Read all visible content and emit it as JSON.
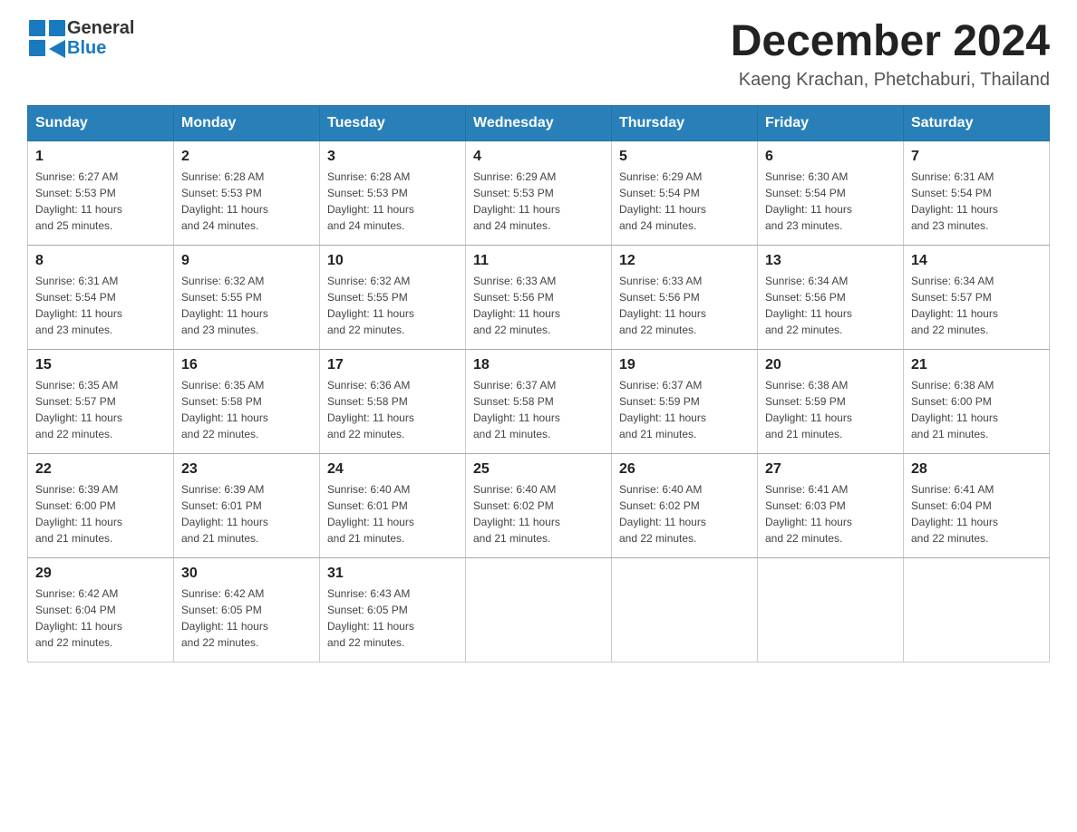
{
  "header": {
    "logo_general": "General",
    "logo_blue": "Blue",
    "month_title": "December 2024",
    "subtitle": "Kaeng Krachan, Phetchaburi, Thailand"
  },
  "days_of_week": [
    "Sunday",
    "Monday",
    "Tuesday",
    "Wednesday",
    "Thursday",
    "Friday",
    "Saturday"
  ],
  "weeks": [
    [
      {
        "day": "1",
        "sunrise": "6:27 AM",
        "sunset": "5:53 PM",
        "daylight": "11 hours and 25 minutes."
      },
      {
        "day": "2",
        "sunrise": "6:28 AM",
        "sunset": "5:53 PM",
        "daylight": "11 hours and 24 minutes."
      },
      {
        "day": "3",
        "sunrise": "6:28 AM",
        "sunset": "5:53 PM",
        "daylight": "11 hours and 24 minutes."
      },
      {
        "day": "4",
        "sunrise": "6:29 AM",
        "sunset": "5:53 PM",
        "daylight": "11 hours and 24 minutes."
      },
      {
        "day": "5",
        "sunrise": "6:29 AM",
        "sunset": "5:54 PM",
        "daylight": "11 hours and 24 minutes."
      },
      {
        "day": "6",
        "sunrise": "6:30 AM",
        "sunset": "5:54 PM",
        "daylight": "11 hours and 23 minutes."
      },
      {
        "day": "7",
        "sunrise": "6:31 AM",
        "sunset": "5:54 PM",
        "daylight": "11 hours and 23 minutes."
      }
    ],
    [
      {
        "day": "8",
        "sunrise": "6:31 AM",
        "sunset": "5:54 PM",
        "daylight": "11 hours and 23 minutes."
      },
      {
        "day": "9",
        "sunrise": "6:32 AM",
        "sunset": "5:55 PM",
        "daylight": "11 hours and 23 minutes."
      },
      {
        "day": "10",
        "sunrise": "6:32 AM",
        "sunset": "5:55 PM",
        "daylight": "11 hours and 22 minutes."
      },
      {
        "day": "11",
        "sunrise": "6:33 AM",
        "sunset": "5:56 PM",
        "daylight": "11 hours and 22 minutes."
      },
      {
        "day": "12",
        "sunrise": "6:33 AM",
        "sunset": "5:56 PM",
        "daylight": "11 hours and 22 minutes."
      },
      {
        "day": "13",
        "sunrise": "6:34 AM",
        "sunset": "5:56 PM",
        "daylight": "11 hours and 22 minutes."
      },
      {
        "day": "14",
        "sunrise": "6:34 AM",
        "sunset": "5:57 PM",
        "daylight": "11 hours and 22 minutes."
      }
    ],
    [
      {
        "day": "15",
        "sunrise": "6:35 AM",
        "sunset": "5:57 PM",
        "daylight": "11 hours and 22 minutes."
      },
      {
        "day": "16",
        "sunrise": "6:35 AM",
        "sunset": "5:58 PM",
        "daylight": "11 hours and 22 minutes."
      },
      {
        "day": "17",
        "sunrise": "6:36 AM",
        "sunset": "5:58 PM",
        "daylight": "11 hours and 22 minutes."
      },
      {
        "day": "18",
        "sunrise": "6:37 AM",
        "sunset": "5:58 PM",
        "daylight": "11 hours and 21 minutes."
      },
      {
        "day": "19",
        "sunrise": "6:37 AM",
        "sunset": "5:59 PM",
        "daylight": "11 hours and 21 minutes."
      },
      {
        "day": "20",
        "sunrise": "6:38 AM",
        "sunset": "5:59 PM",
        "daylight": "11 hours and 21 minutes."
      },
      {
        "day": "21",
        "sunrise": "6:38 AM",
        "sunset": "6:00 PM",
        "daylight": "11 hours and 21 minutes."
      }
    ],
    [
      {
        "day": "22",
        "sunrise": "6:39 AM",
        "sunset": "6:00 PM",
        "daylight": "11 hours and 21 minutes."
      },
      {
        "day": "23",
        "sunrise": "6:39 AM",
        "sunset": "6:01 PM",
        "daylight": "11 hours and 21 minutes."
      },
      {
        "day": "24",
        "sunrise": "6:40 AM",
        "sunset": "6:01 PM",
        "daylight": "11 hours and 21 minutes."
      },
      {
        "day": "25",
        "sunrise": "6:40 AM",
        "sunset": "6:02 PM",
        "daylight": "11 hours and 21 minutes."
      },
      {
        "day": "26",
        "sunrise": "6:40 AM",
        "sunset": "6:02 PM",
        "daylight": "11 hours and 22 minutes."
      },
      {
        "day": "27",
        "sunrise": "6:41 AM",
        "sunset": "6:03 PM",
        "daylight": "11 hours and 22 minutes."
      },
      {
        "day": "28",
        "sunrise": "6:41 AM",
        "sunset": "6:04 PM",
        "daylight": "11 hours and 22 minutes."
      }
    ],
    [
      {
        "day": "29",
        "sunrise": "6:42 AM",
        "sunset": "6:04 PM",
        "daylight": "11 hours and 22 minutes."
      },
      {
        "day": "30",
        "sunrise": "6:42 AM",
        "sunset": "6:05 PM",
        "daylight": "11 hours and 22 minutes."
      },
      {
        "day": "31",
        "sunrise": "6:43 AM",
        "sunset": "6:05 PM",
        "daylight": "11 hours and 22 minutes."
      },
      null,
      null,
      null,
      null
    ]
  ],
  "labels": {
    "sunrise": "Sunrise:",
    "sunset": "Sunset:",
    "daylight": "Daylight:"
  }
}
